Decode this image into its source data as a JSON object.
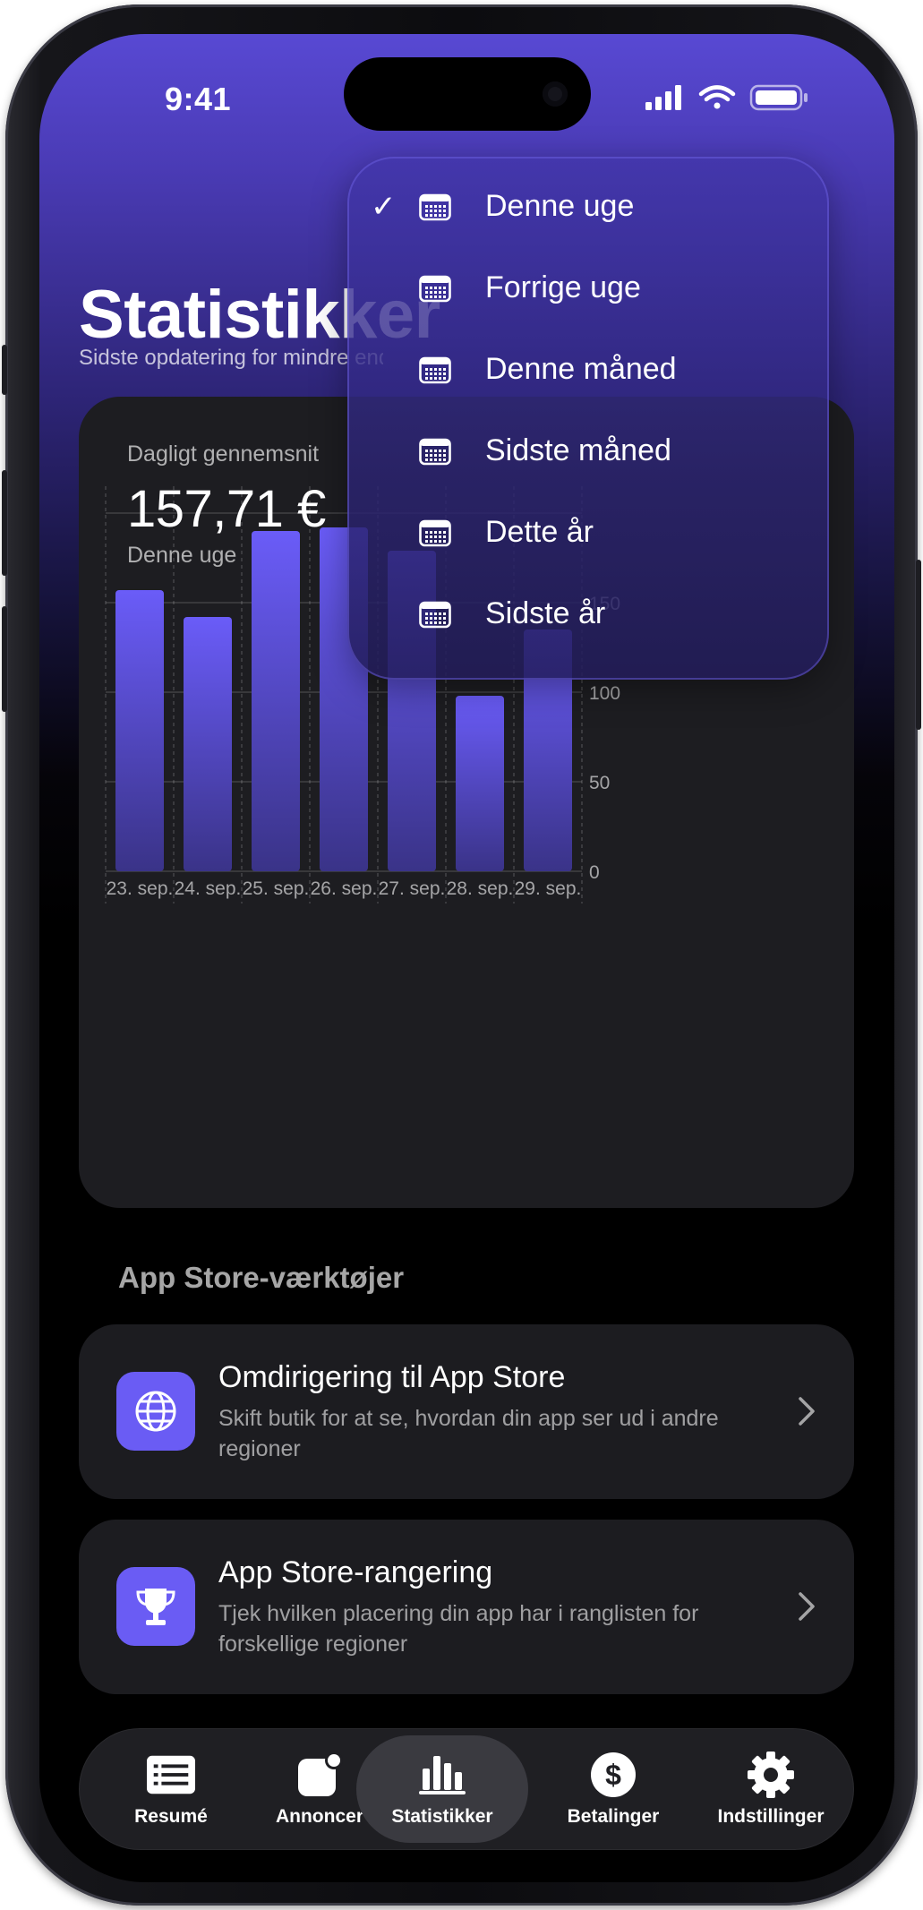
{
  "status_bar": {
    "time": "9:41"
  },
  "header": {
    "title": "Statistikker",
    "subtitle": "Sidste opdatering for mindre end 1 minut siden"
  },
  "summary": {
    "label": "Dagligt gennemsnit",
    "value": "157,71 €",
    "period": "Denne uge"
  },
  "chart_data": {
    "type": "bar",
    "categories": [
      "23. sep.",
      "24. sep.",
      "25. sep.",
      "26. sep.",
      "27. sep.",
      "28. sep.",
      "29. sep."
    ],
    "values": [
      157,
      142,
      190,
      192,
      179,
      98,
      135
    ],
    "y_ticks": [
      "0",
      "50",
      "100",
      "150"
    ],
    "ylim": [
      0,
      200
    ],
    "grid": true,
    "y_axis_position": "right",
    "bar_color_top": "#6a5cf8",
    "bar_color_bottom": "#3a3388"
  },
  "period_menu": {
    "selected_index": 0,
    "check_mark": "✓",
    "items": [
      {
        "label": "Denne uge",
        "icon": "calendar-icon"
      },
      {
        "label": "Forrige uge",
        "icon": "calendar-icon"
      },
      {
        "label": "Denne måned",
        "icon": "calendar-icon"
      },
      {
        "label": "Sidste måned",
        "icon": "calendar-icon"
      },
      {
        "label": "Dette år",
        "icon": "calendar-icon"
      },
      {
        "label": "Sidste år",
        "icon": "calendar-icon"
      }
    ]
  },
  "tools": {
    "header": "App Store-værktøjer",
    "items": [
      {
        "title": "Omdirigering til App Store",
        "description": "Skift butik for at se, hvordan din app ser ud i andre regioner",
        "icon": "globe-icon"
      },
      {
        "title": "App Store-rangering",
        "description": "Tjek hvilken placering din app har i ranglisten for forskellige regioner",
        "icon": "trophy-icon"
      }
    ]
  },
  "tab_bar": {
    "active_index": 2,
    "items": [
      {
        "label": "Resumé",
        "icon": "list-icon"
      },
      {
        "label": "Annoncer",
        "icon": "ads-icon"
      },
      {
        "label": "Statistikker",
        "icon": "chart-icon"
      },
      {
        "label": "Betalinger",
        "icon": "dollar-icon"
      },
      {
        "label": "Indstillinger",
        "icon": "gear-icon"
      }
    ]
  },
  "colors": {
    "accent": "#6a5cf4",
    "header_gradient_top": "#5849d3",
    "card_background": "#1d1d21"
  }
}
